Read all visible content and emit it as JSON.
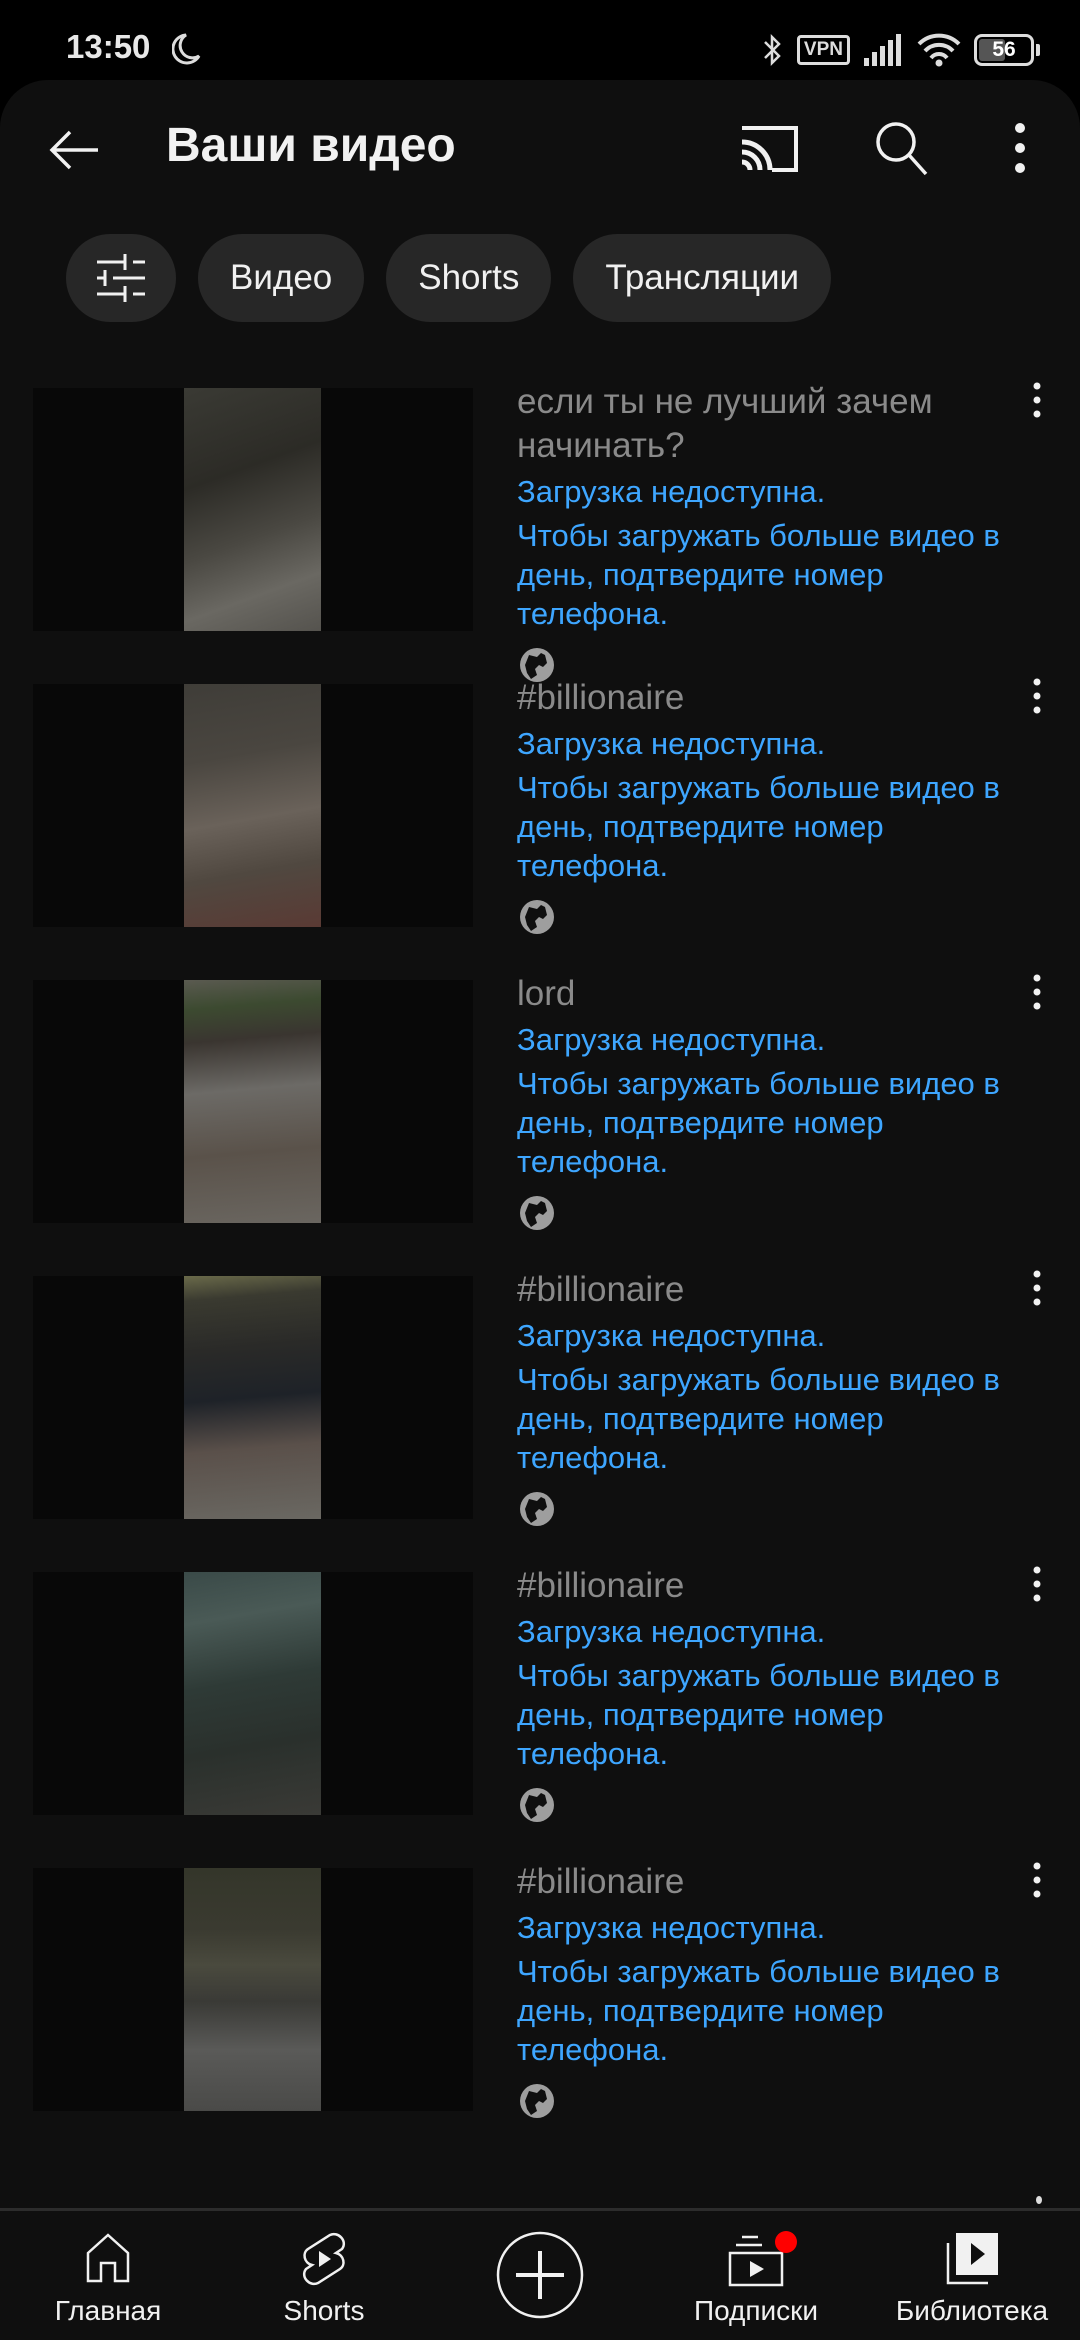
{
  "status_bar": {
    "time": "13:50",
    "icons": [
      "moon-icon",
      "bluetooth-icon",
      "vpn-icon",
      "signal-icon",
      "wifi-icon",
      "battery-icon"
    ],
    "vpn_label": "VPN",
    "battery_percent": "56",
    "battery_level": 0.56
  },
  "header": {
    "title": "Ваши видео",
    "back_icon": "arrow-left-icon",
    "cast_icon": "cast-icon",
    "search_icon": "search-icon",
    "more_icon": "more-vertical-icon"
  },
  "filters": {
    "filter_icon": "sliders-icon",
    "chips": [
      {
        "label": "Видео"
      },
      {
        "label": "Shorts"
      },
      {
        "label": "Трансляции"
      }
    ]
  },
  "videos": [
    {
      "title": "если ты не лучший зачем начинать?",
      "status": "Загрузка недоступна.",
      "detail": "Чтобы загружать больше видео в день, подтвердите номер телефона.",
      "visibility": "public-globe-icon"
    },
    {
      "title": "#billionaire",
      "status": "Загрузка недоступна.",
      "detail": "Чтобы загружать больше видео в день, подтвердите номер телефона.",
      "visibility": "public-globe-icon"
    },
    {
      "title": "lord",
      "status": "Загрузка недоступна.",
      "detail": "Чтобы загружать больше видео в день, подтвердите номер телефона.",
      "visibility": "public-globe-icon"
    },
    {
      "title": "#billionaire",
      "status": "Загрузка недоступна.",
      "detail": "Чтобы загружать больше видео в день, подтвердите номер телефона.",
      "visibility": "public-globe-icon"
    },
    {
      "title": "#billionaire",
      "status": "Загрузка недоступна.",
      "detail": "Чтобы загружать больше видео в день, подтвердите номер телефона.",
      "visibility": "public-globe-icon"
    },
    {
      "title": "#billionaire",
      "status": "Загрузка недоступна.",
      "detail": "Чтобы загружать больше видео в день, подтвердите номер телефона.",
      "visibility": "public-globe-icon"
    }
  ],
  "bottom_nav": {
    "items": [
      {
        "label": "Главная",
        "icon": "home-icon"
      },
      {
        "label": "Shorts",
        "icon": "shorts-icon"
      },
      {
        "label": "",
        "icon": "create-plus-icon"
      },
      {
        "label": "Подписки",
        "icon": "subscriptions-icon",
        "badge": true
      },
      {
        "label": "Библиотека",
        "icon": "library-icon"
      }
    ]
  },
  "colors": {
    "background": "#0f0f0f",
    "chip": "#272727",
    "link_blue": "#3ea6ff",
    "title_gray": "#8a8a8a",
    "badge_red": "#ff0000"
  }
}
